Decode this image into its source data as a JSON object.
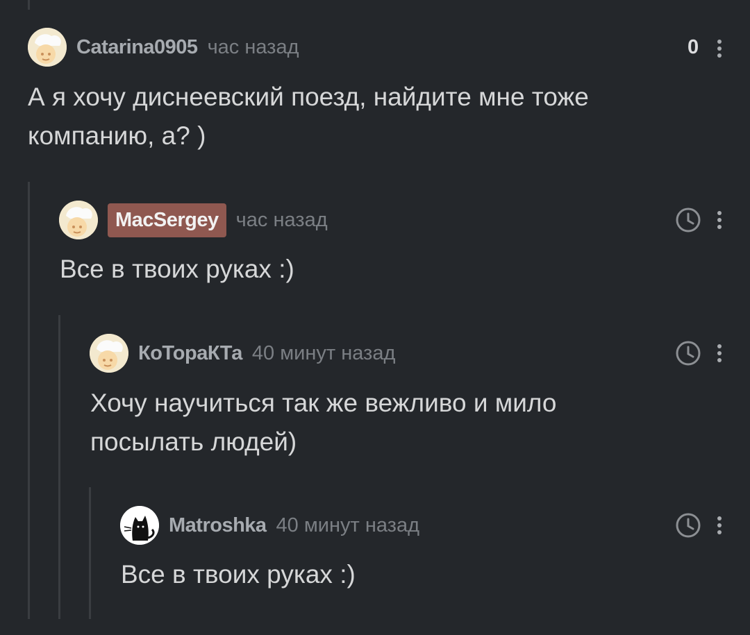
{
  "comments": [
    {
      "author": "Catarina0905",
      "time": "час назад",
      "score": "0",
      "text": "А я хочу диснеевский поезд, найдите мне тоже компанию, а? )"
    },
    {
      "author": "MacSergey",
      "time": "час назад",
      "text": "Все в твоих руках :)"
    },
    {
      "author": "КоТораКТа",
      "time": "40 минут назад",
      "text": "Хочу научиться так же вежливо и мило посылать людей)"
    },
    {
      "author": "Matroshka",
      "time": "40 минут назад",
      "text": "Все в твоих руках :)"
    }
  ],
  "colors": {
    "background": "#24272b",
    "author_badge": "#8f5850",
    "thread_line": "#3a3d41"
  }
}
